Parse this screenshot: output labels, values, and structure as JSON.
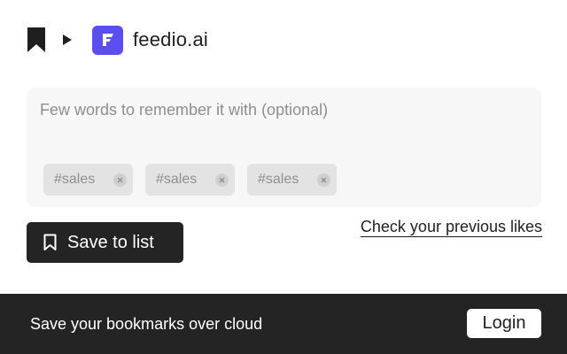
{
  "header": {
    "site_name": "feedio.ai",
    "bookmark_icon": "bookmark-icon",
    "arrow_icon": "play-arrow-icon",
    "site_logo_icon": "feedio-logo-icon",
    "site_logo_color": "#5b4ef0"
  },
  "note": {
    "placeholder": "Few words to remember it with (optional)",
    "value": ""
  },
  "tags": [
    {
      "label": "#sales"
    },
    {
      "label": "#sales"
    },
    {
      "label": "#sales"
    }
  ],
  "actions": {
    "save_label": "Save to list",
    "previous_likes_label": "Check your previous likes"
  },
  "footer": {
    "text": "Save your bookmarks over cloud",
    "login_label": "Login",
    "background": "#242424"
  }
}
